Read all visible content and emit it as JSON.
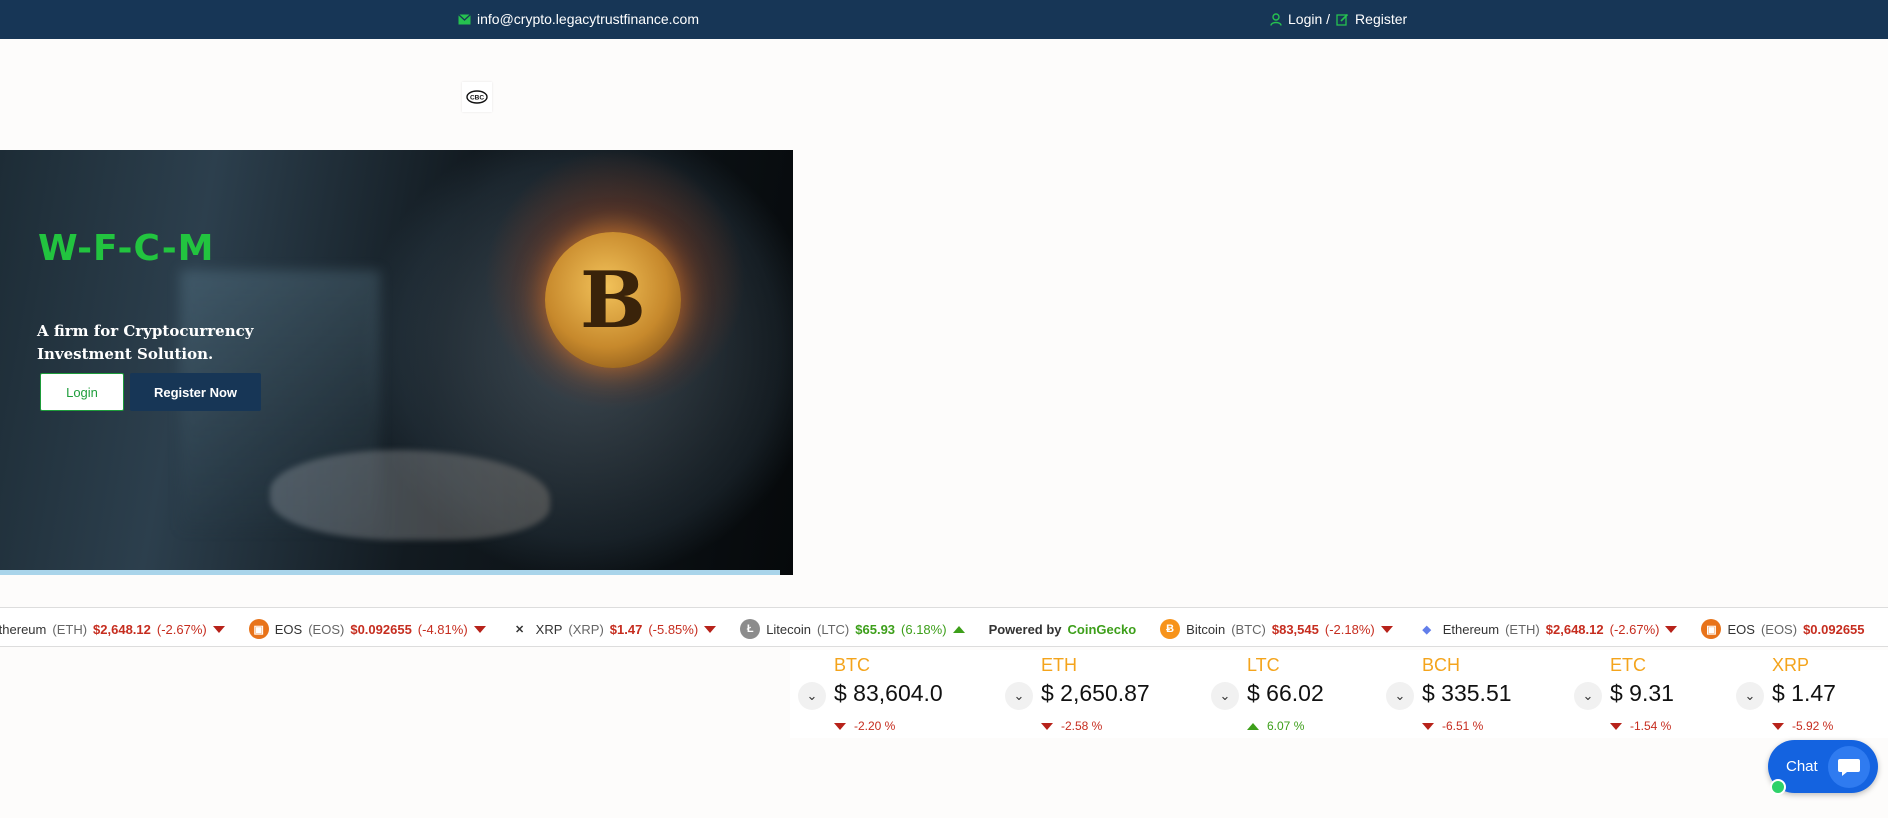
{
  "topbar": {
    "email": "info@crypto.legacytrustfinance.com",
    "login": "Login /",
    "register": "Register"
  },
  "logo": {
    "text": "CBC"
  },
  "hero": {
    "title": "W-F-C-M",
    "tagline": "A firm for Cryptocurrency Investment Solution.",
    "login_button": "Login",
    "register_button": "Register Now",
    "coin_symbol": "B"
  },
  "ticker": {
    "items": [
      {
        "name": "Ethereum",
        "sym": "(ETH)",
        "price": "$2,648.12",
        "change": "(-2.67%)",
        "dir": "down",
        "icon": "ethereum-icon"
      },
      {
        "name": "EOS",
        "sym": "(EOS)",
        "price": "$0.092655",
        "change": "(-4.81%)",
        "dir": "down",
        "icon": "eos-icon"
      },
      {
        "name": "XRP",
        "sym": "(XRP)",
        "price": "$1.47",
        "change": "(-5.85%)",
        "dir": "down",
        "icon": "xrp-icon"
      },
      {
        "name": "Litecoin",
        "sym": "(LTC)",
        "price": "$65.93",
        "change": "(6.18%)",
        "dir": "up",
        "icon": "litecoin-icon"
      },
      {
        "name": "Bitcoin",
        "sym": "(BTC)",
        "price": "$83,545",
        "change": "(-2.18%)",
        "dir": "down",
        "icon": "bitcoin-icon"
      },
      {
        "name": "Ethereum",
        "sym": "(ETH)",
        "price": "$2,648.12",
        "change": "(-2.67%)",
        "dir": "down",
        "icon": "ethereum-icon"
      },
      {
        "name": "EOS",
        "sym": "(EOS)",
        "price": "$0.092655",
        "change": "",
        "dir": "",
        "icon": "eos-icon"
      }
    ],
    "powered_by": "Powered by",
    "provider": "CoinGecko"
  },
  "prices": [
    {
      "sym": "BTC",
      "value": "$ 83,604.0",
      "change": "-2.20 %",
      "dir": "down"
    },
    {
      "sym": "ETH",
      "value": "$ 2,650.87",
      "change": "-2.58 %",
      "dir": "down"
    },
    {
      "sym": "LTC",
      "value": "$ 66.02",
      "change": "6.07 %",
      "dir": "up"
    },
    {
      "sym": "BCH",
      "value": "$ 335.51",
      "change": "-6.51 %",
      "dir": "down"
    },
    {
      "sym": "ETC",
      "value": "$ 9.31",
      "change": "-1.54 %",
      "dir": "down"
    },
    {
      "sym": "XRP",
      "value": "$ 1.47",
      "change": "-5.92 %",
      "dir": "down"
    }
  ],
  "chat": {
    "label": "Chat"
  },
  "colors": {
    "navy": "#173656",
    "green": "#22c43f",
    "up": "#3d9f1a",
    "down": "#c62d1f",
    "accent": "#f4a41c",
    "chat": "#1463e0"
  }
}
